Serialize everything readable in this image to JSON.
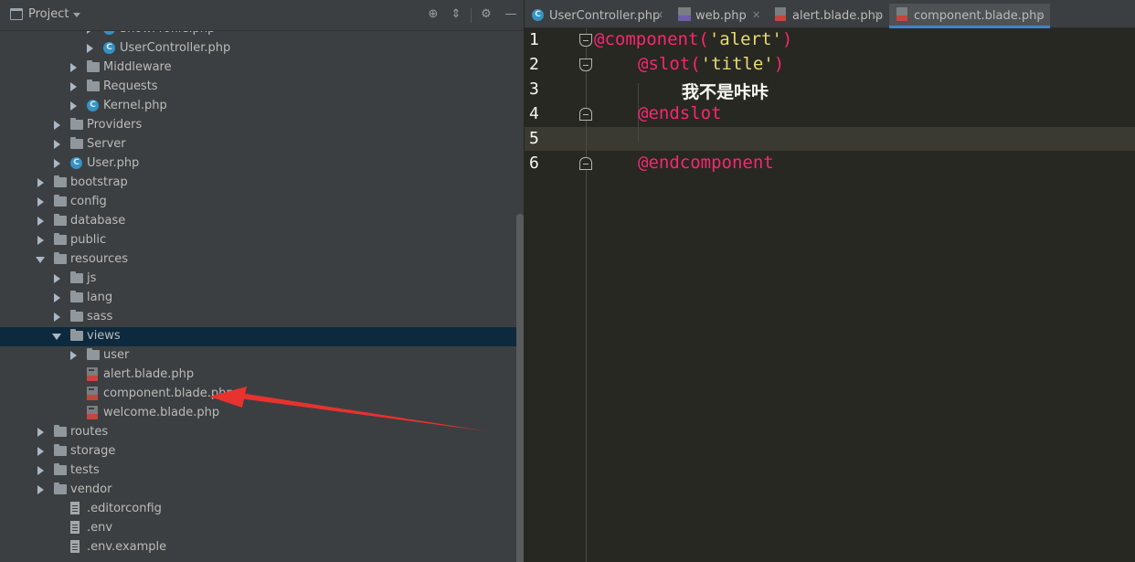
{
  "project_panel": {
    "title": "Project",
    "tree": [
      {
        "label": "ShowProfile.php",
        "type": "class",
        "expander": "closed",
        "depth": 4
      },
      {
        "label": "UserController.php",
        "type": "class",
        "expander": "closed",
        "depth": 4
      },
      {
        "label": "Middleware",
        "type": "folder",
        "expander": "closed",
        "depth": 3
      },
      {
        "label": "Requests",
        "type": "folder",
        "expander": "closed",
        "depth": 3
      },
      {
        "label": "Kernel.php",
        "type": "class",
        "expander": "closed",
        "depth": 3
      },
      {
        "label": "Providers",
        "type": "folder",
        "expander": "closed",
        "depth": 2
      },
      {
        "label": "Server",
        "type": "folder",
        "expander": "closed",
        "depth": 2
      },
      {
        "label": "User.php",
        "type": "class",
        "expander": "closed",
        "depth": 2
      },
      {
        "label": "bootstrap",
        "type": "folder",
        "expander": "closed",
        "depth": 1
      },
      {
        "label": "config",
        "type": "folder",
        "expander": "closed",
        "depth": 1
      },
      {
        "label": "database",
        "type": "folder",
        "expander": "closed",
        "depth": 1
      },
      {
        "label": "public",
        "type": "folder",
        "expander": "closed",
        "depth": 1
      },
      {
        "label": "resources",
        "type": "folder",
        "expander": "open",
        "depth": 1
      },
      {
        "label": "js",
        "type": "folder",
        "expander": "closed",
        "depth": 2
      },
      {
        "label": "lang",
        "type": "folder",
        "expander": "closed",
        "depth": 2
      },
      {
        "label": "sass",
        "type": "folder",
        "expander": "closed",
        "depth": 2
      },
      {
        "label": "views",
        "type": "folder",
        "expander": "open",
        "depth": 2,
        "selected": true
      },
      {
        "label": "user",
        "type": "folder",
        "expander": "closed",
        "depth": 3
      },
      {
        "label": "alert.blade.php",
        "type": "blade",
        "expander": "none",
        "depth": 3
      },
      {
        "label": "component.blade.php",
        "type": "blade",
        "expander": "none",
        "depth": 3
      },
      {
        "label": "welcome.blade.php",
        "type": "blade",
        "expander": "none",
        "depth": 3
      },
      {
        "label": "routes",
        "type": "folder",
        "expander": "closed",
        "depth": 1
      },
      {
        "label": "storage",
        "type": "folder",
        "expander": "closed",
        "depth": 1
      },
      {
        "label": "tests",
        "type": "folder",
        "expander": "closed",
        "depth": 1
      },
      {
        "label": "vendor",
        "type": "folder",
        "expander": "closed",
        "depth": 1
      },
      {
        "label": ".editorconfig",
        "type": "file",
        "expander": "none",
        "depth": 2
      },
      {
        "label": ".env",
        "type": "file",
        "expander": "none",
        "depth": 2
      },
      {
        "label": ".env.example",
        "type": "file",
        "expander": "none",
        "depth": 2
      }
    ]
  },
  "editor": {
    "tabs": [
      {
        "label": "UserController.php",
        "icon": "class",
        "active": false
      },
      {
        "label": "web.php",
        "icon": "php",
        "active": false
      },
      {
        "label": "alert.blade.php",
        "icon": "blade",
        "active": false
      },
      {
        "label": "component.blade.php",
        "icon": "blade",
        "active": true
      }
    ],
    "lines": [
      {
        "number": "1",
        "fold": "start",
        "indent": 0,
        "tokens": [
          {
            "t": "dir",
            "v": "@component("
          },
          {
            "t": "str",
            "v": "'alert'"
          },
          {
            "t": "dir",
            "v": ")"
          }
        ]
      },
      {
        "number": "2",
        "fold": "start",
        "indent": 1,
        "tokens": [
          {
            "t": "dir",
            "v": "@slot("
          },
          {
            "t": "str",
            "v": "'title'"
          },
          {
            "t": "dir",
            "v": ")"
          }
        ]
      },
      {
        "number": "3",
        "fold": "none",
        "indent": 2,
        "tokens": [
          {
            "t": "text",
            "v": "我不是咔咔"
          }
        ]
      },
      {
        "number": "4",
        "fold": "end",
        "indent": 1,
        "tokens": [
          {
            "t": "dir",
            "v": "@endslot"
          }
        ]
      },
      {
        "number": "5",
        "fold": "none",
        "indent": 0,
        "tokens": []
      },
      {
        "number": "6",
        "fold": "end",
        "indent": 1,
        "tokens": [
          {
            "t": "dir",
            "v": "@endcomponent"
          }
        ]
      }
    ],
    "current_line": 5
  },
  "colors": {
    "panel_bg": "#3c3f41",
    "editor_bg": "#272822",
    "selection": "#0d293e",
    "directive": "#f92672",
    "string": "#e6db74",
    "annotation_arrow": "#e8322e"
  }
}
